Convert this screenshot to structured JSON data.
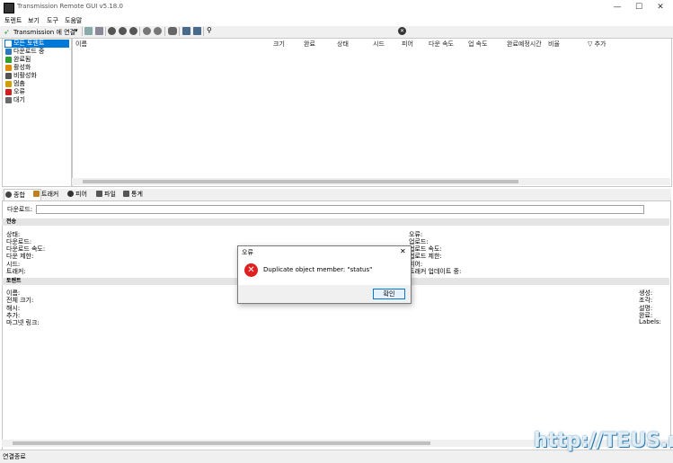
{
  "window": {
    "title": "Transmission Remote GUI v5.18.0"
  },
  "menu": [
    "토렌트",
    "보기",
    "도구",
    "도움말"
  ],
  "toolbar": {
    "connect_label": "Transmission 에 연결"
  },
  "sidebar": {
    "items": [
      {
        "label": "모든 토렌트",
        "color": "#2a7ac0"
      },
      {
        "label": "다운로드 중",
        "color": "#2a7ac0"
      },
      {
        "label": "완료됨",
        "color": "#2da02d"
      },
      {
        "label": "활성화",
        "color": "#e08a00"
      },
      {
        "label": "비활성화",
        "color": "#555555"
      },
      {
        "label": "멈춤",
        "color": "#d0a000"
      },
      {
        "label": "오류",
        "color": "#d02020"
      },
      {
        "label": "대기",
        "color": "#6a6a6a"
      }
    ]
  },
  "torrent_list": {
    "columns": [
      "이름",
      "크기",
      "완료",
      "상태",
      "시드",
      "피어",
      "다운 속도",
      "업 속도",
      "완료예정시간",
      "비율",
      "▽ 추가"
    ]
  },
  "tabs": [
    "종합",
    "트래커",
    "피어",
    "파일",
    "통계"
  ],
  "general": {
    "download_label": "다운로드:",
    "transfer_header": "전송",
    "transfer_left": [
      "상태:",
      "다운로드:",
      "다운로드 속도:",
      "다운 제한:",
      "시드:",
      "트래커:"
    ],
    "transfer_right": [
      "오류:",
      "업로드:",
      "업로드 속도:",
      "업로드 제한:",
      "피어:",
      "트래커 업데이트 중:"
    ],
    "torrent_header": "토렌트",
    "torrent_left": [
      "이름:",
      "전체 크기:",
      "해시:",
      "추가:",
      "마그넷 링크:"
    ],
    "torrent_right": [
      "생성:",
      "조각:",
      "설명:",
      "완료:",
      "Labels:"
    ]
  },
  "status": {
    "text": "연결종료"
  },
  "dialog": {
    "title": "오류",
    "message": "Duplicate object member: \"status\"",
    "ok_label": "확인"
  },
  "watermark": {
    "text": "http://TEUS.me"
  }
}
